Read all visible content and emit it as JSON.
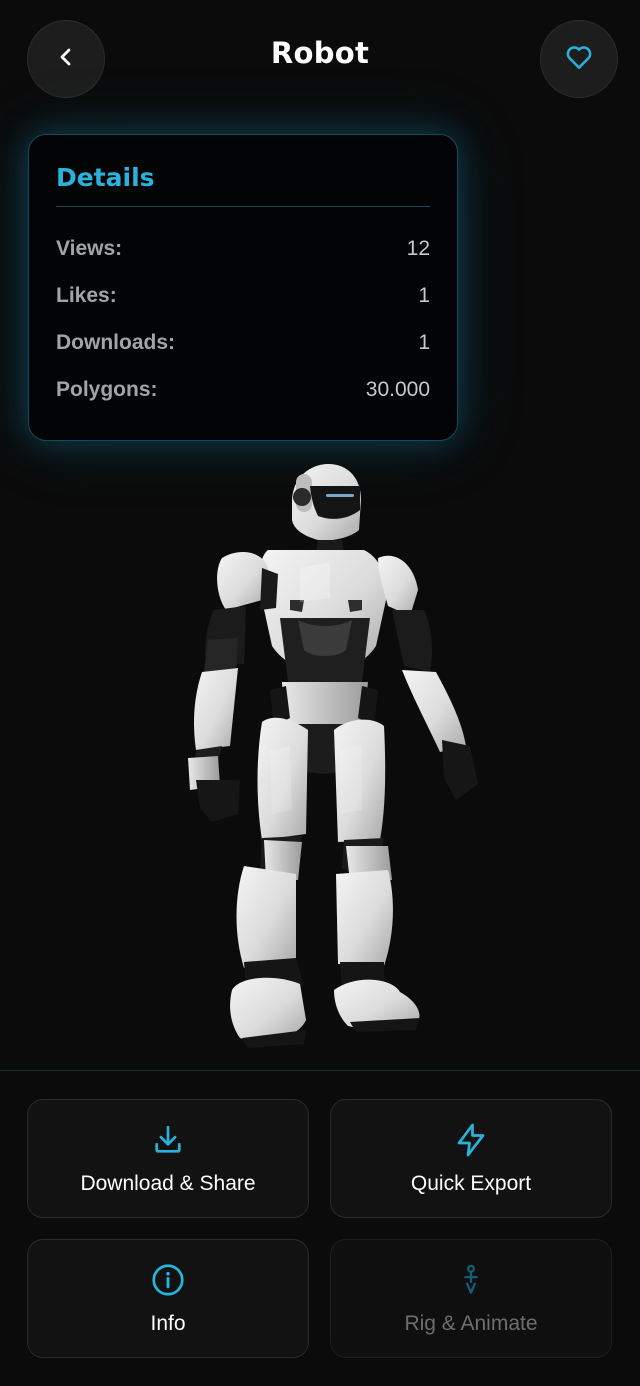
{
  "header": {
    "title": "Robot",
    "back_icon": "chevron-left-icon",
    "favorite_icon": "heart-icon"
  },
  "details": {
    "heading": "Details",
    "stats": [
      {
        "label": "Views:",
        "value": "12"
      },
      {
        "label": "Likes:",
        "value": "1"
      },
      {
        "label": "Downloads:",
        "value": "1"
      },
      {
        "label": "Polygons:",
        "value": "30.000"
      }
    ]
  },
  "actions": {
    "download_share": {
      "label": "Download & Share",
      "icon": "download-icon"
    },
    "quick_export": {
      "label": "Quick Export",
      "icon": "lightning-icon"
    },
    "info": {
      "label": "Info",
      "icon": "info-icon"
    },
    "rig_animate": {
      "label": "Rig & Animate",
      "icon": "rig-icon",
      "enabled": false
    }
  },
  "colors": {
    "accent": "#29b3dc",
    "background": "#0b0b0b",
    "card_background": "#121212"
  }
}
